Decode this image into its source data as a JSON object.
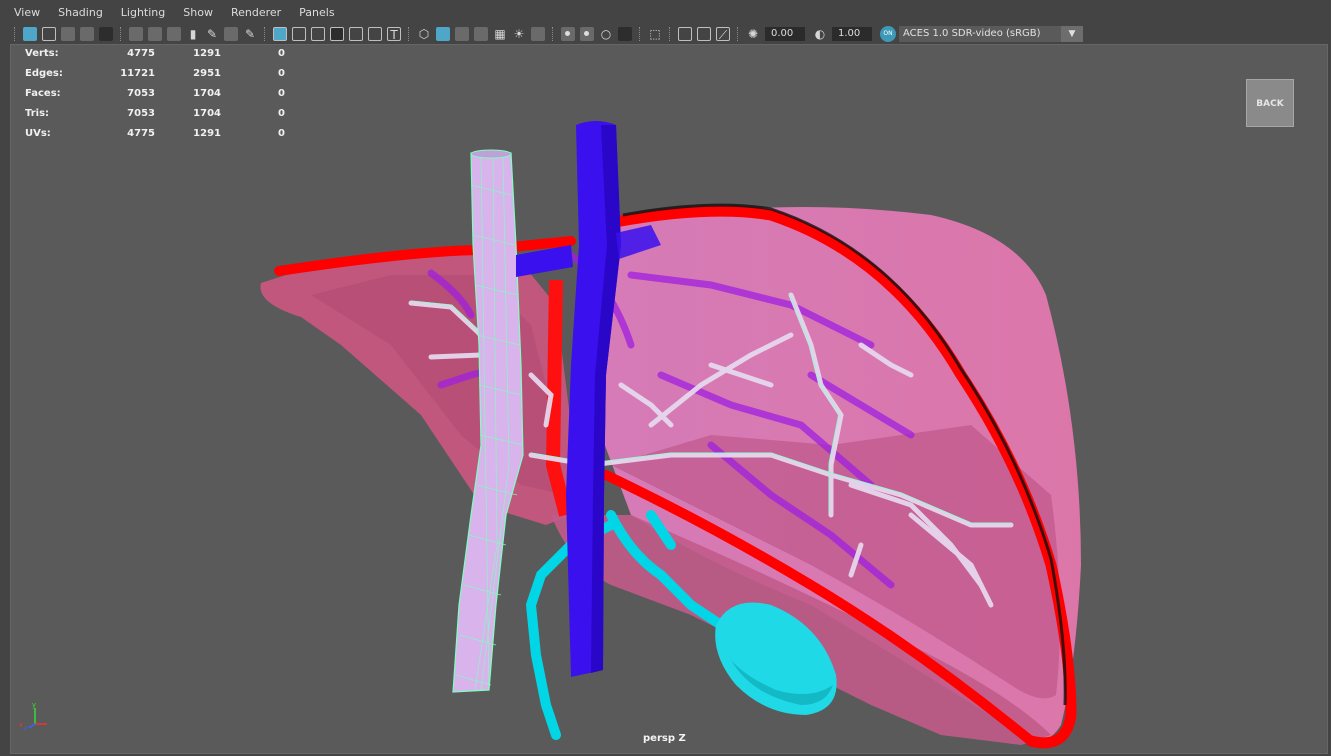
{
  "menu": [
    "View",
    "Shading",
    "Lighting",
    "Show",
    "Renderer",
    "Panels"
  ],
  "toolbar": {
    "exposure": "0.00",
    "gamma": "1.00",
    "on_badge": "ON",
    "color_space": "ACES 1.0 SDR-video (sRGB)"
  },
  "hud": [
    {
      "label": "Verts:",
      "v1": "4775",
      "v2": "1291",
      "v3": "0"
    },
    {
      "label": "Edges:",
      "v1": "11721",
      "v2": "2951",
      "v3": "0"
    },
    {
      "label": "Faces:",
      "v1": "7053",
      "v2": "1704",
      "v3": "0"
    },
    {
      "label": "Tris:",
      "v1": "7053",
      "v2": "1704",
      "v3": "0"
    },
    {
      "label": "UVs:",
      "v1": "4775",
      "v2": "1291",
      "v3": "0"
    }
  ],
  "back_button": "BACK",
  "camera_label": "persp Z",
  "axis_labels": {
    "x": "x",
    "y": "y",
    "z": "z"
  },
  "colors": {
    "viewport_bg": "#5a5a5a",
    "liver": "#e07aa8",
    "artery": "#ff0000",
    "vena_cava": "#3300ee",
    "portal_vein": "#c9a8e6",
    "bile_duct": "#00d8e8",
    "wireframe": "#7fffc0"
  }
}
